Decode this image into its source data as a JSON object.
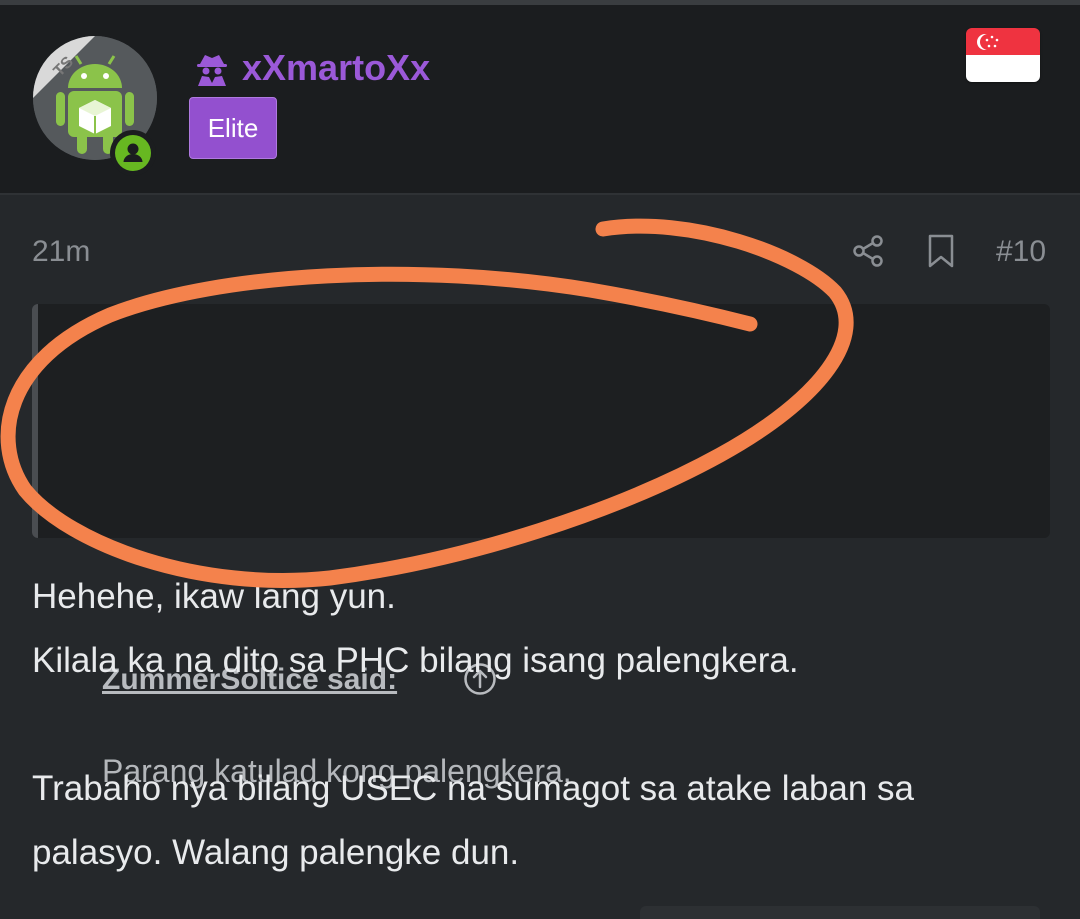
{
  "author": {
    "username": "xXmartoXx",
    "badge": "Elite",
    "avatar_ribbon": "TS",
    "username_color": "#9b59d8",
    "badge_color": "#9350cf",
    "online_status_color": "#67b821",
    "status_icon": "user-icon",
    "role_icon": "spy-icon",
    "country_flag": "singapore-flag-icon"
  },
  "post_meta": {
    "time": "21m",
    "share_icon": "share-icon",
    "bookmark_icon": "bookmark-icon",
    "post_number": "#10"
  },
  "quote": {
    "author": "ZummerSoltice said:",
    "jump_icon": "arrow-up-circle-icon",
    "text": "Parang katulad kong palengkera."
  },
  "body": {
    "lines": [
      "Hehehe, ikaw lang yun.",
      "Kilala ka na dito sa PHC bilang isang palengkera.",
      "Trabaho nya bilang USEC na sumagot sa atake laban sa palasyo. Walang palengke dun."
    ]
  },
  "annotation": {
    "shape": "hand-drawn-circle",
    "color": "#f4824c"
  }
}
